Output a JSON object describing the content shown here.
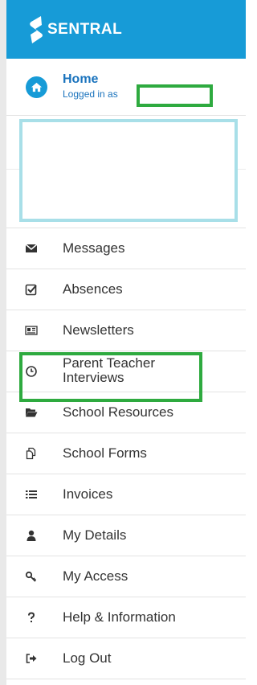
{
  "app": {
    "brand": "SENTRAL"
  },
  "home": {
    "title": "Home",
    "subtitle": "Logged in as"
  },
  "menu": {
    "items": [
      {
        "id": "messages",
        "label": "Messages",
        "icon": "envelope-icon"
      },
      {
        "id": "absences",
        "label": "Absences",
        "icon": "checkbox-icon"
      },
      {
        "id": "newsletters",
        "label": "Newsletters",
        "icon": "newspaper-icon"
      },
      {
        "id": "parent-teacher-interviews",
        "label": "Parent Teacher Interviews",
        "icon": "clock-icon"
      },
      {
        "id": "school-resources",
        "label": "School Resources",
        "icon": "folder-open-icon"
      },
      {
        "id": "school-forms",
        "label": "School Forms",
        "icon": "documents-icon"
      },
      {
        "id": "invoices",
        "label": "Invoices",
        "icon": "list-icon"
      },
      {
        "id": "my-details",
        "label": "My Details",
        "icon": "user-icon"
      },
      {
        "id": "my-access",
        "label": "My Access",
        "icon": "key-icon"
      },
      {
        "id": "help-information",
        "label": "Help & Information",
        "icon": "question-icon"
      },
      {
        "id": "log-out",
        "label": "Log Out",
        "icon": "sign-out-icon"
      }
    ]
  },
  "colors": {
    "brand": "#179bd7",
    "link": "#1a73bd",
    "highlight": "#2eaa3f",
    "profile_outline": "#a8dfe8"
  }
}
